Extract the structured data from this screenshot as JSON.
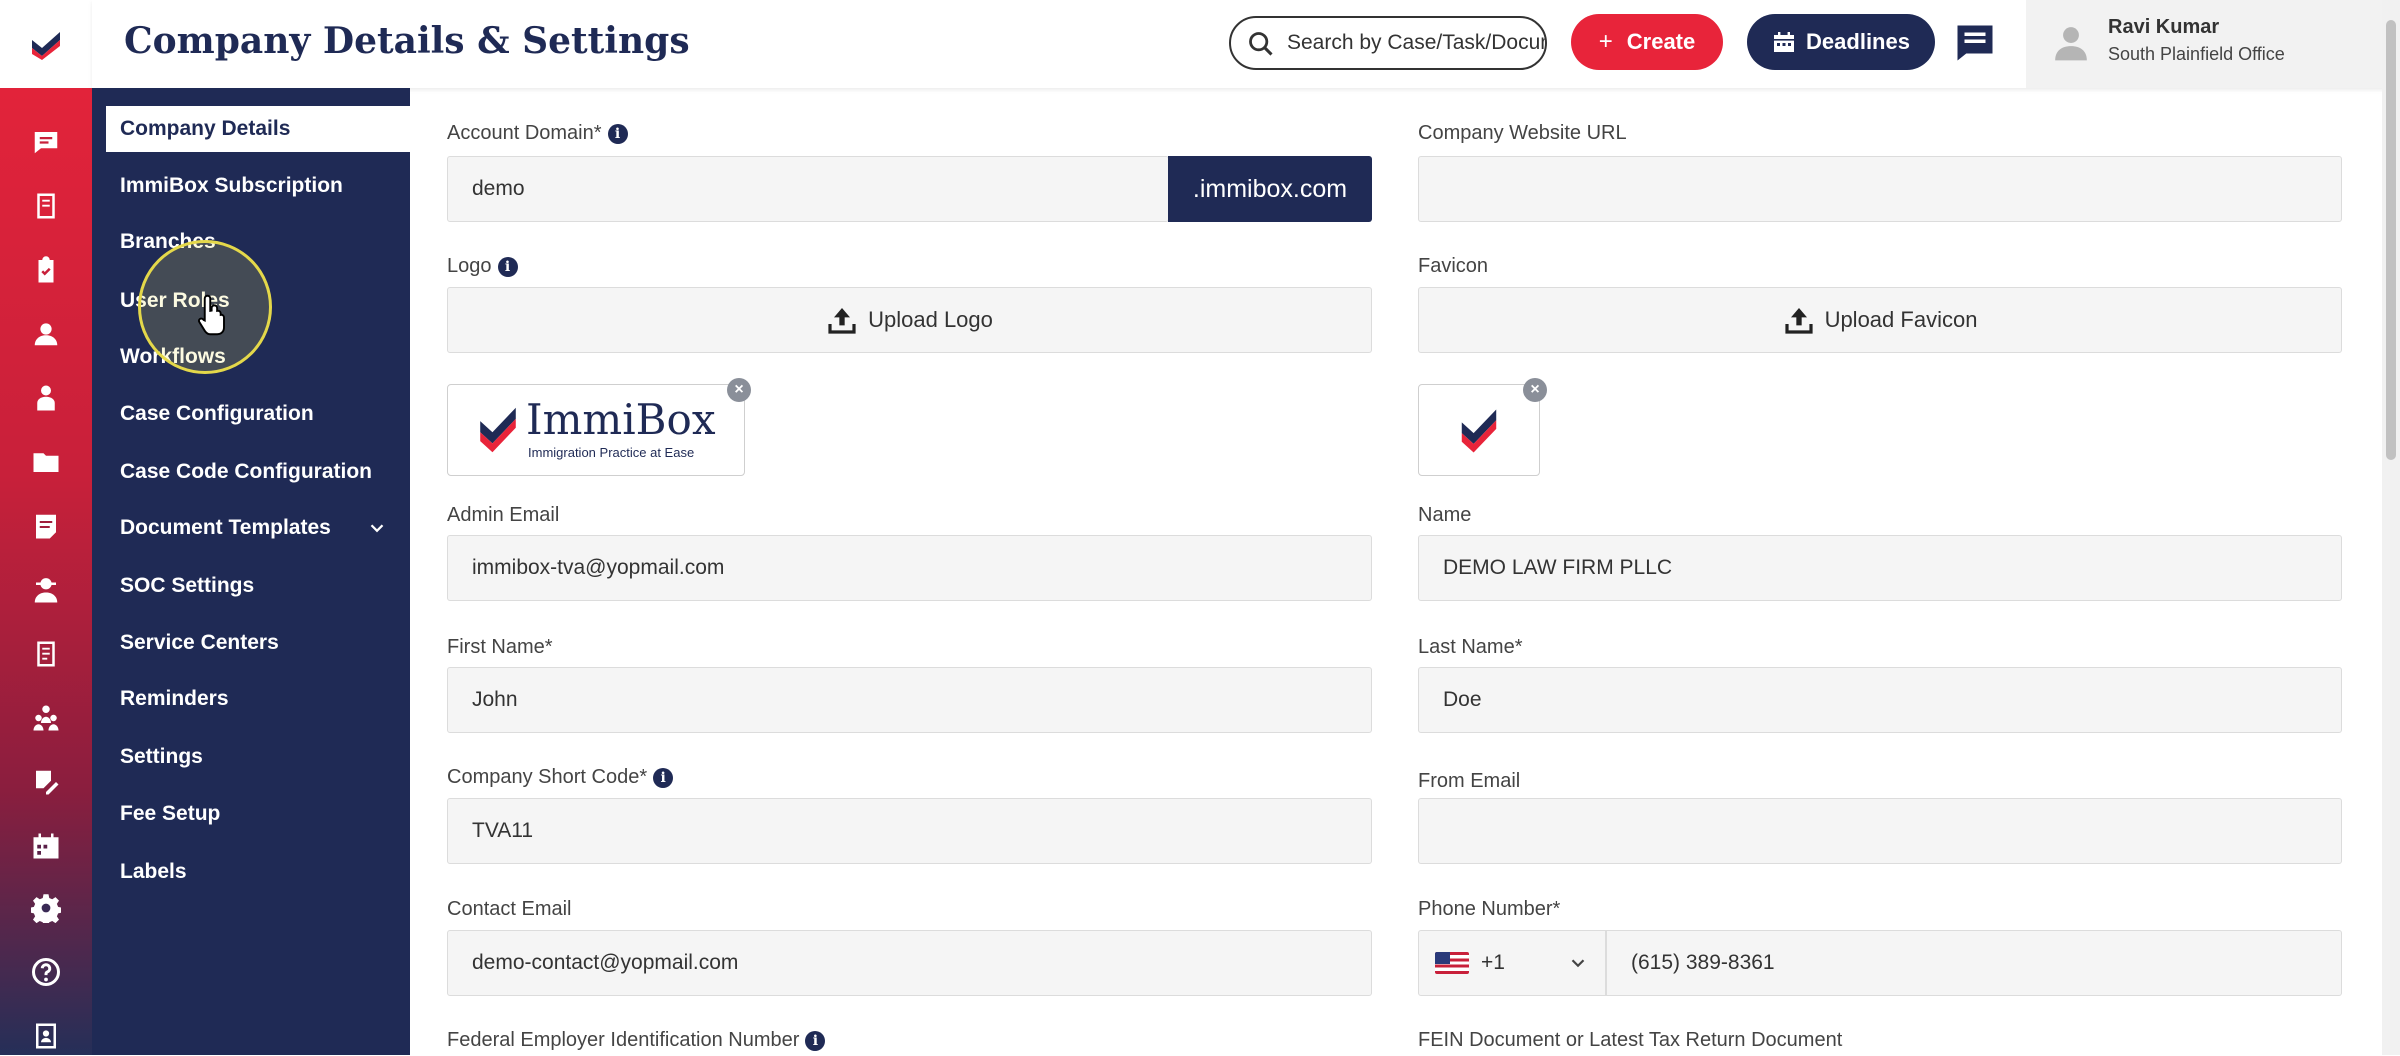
{
  "header": {
    "title": "Company Details & Settings",
    "search_placeholder": "Search by Case/Task/Document",
    "create_label": "Create",
    "deadlines_label": "Deadlines",
    "user_name": "Ravi Kumar",
    "user_office": "South Plainfield Office"
  },
  "sidebar": {
    "items": [
      {
        "label": "Company Details",
        "active": true
      },
      {
        "label": "ImmiBox Subscription"
      },
      {
        "label": "Branches"
      },
      {
        "label": "User Roles"
      },
      {
        "label": "Workflows"
      },
      {
        "label": "Case Configuration"
      },
      {
        "label": "Case Code Configuration"
      },
      {
        "label": "Document Templates",
        "has_submenu": true
      },
      {
        "label": "SOC Settings"
      },
      {
        "label": "Service Centers"
      },
      {
        "label": "Reminders"
      },
      {
        "label": "Settings"
      },
      {
        "label": "Fee Setup"
      },
      {
        "label": "Labels"
      }
    ]
  },
  "rail_icons": [
    "chat-icon",
    "book-icon",
    "clipboard-icon",
    "user-icon",
    "person-icon",
    "folder-icon",
    "document-icon",
    "agent-icon",
    "ledger-icon",
    "group-icon",
    "edit-icon",
    "calendar-icon",
    "gear-icon",
    "help-icon",
    "contacts-icon"
  ],
  "form": {
    "account_domain": {
      "label": "Account Domain*",
      "value": "demo",
      "suffix": ".immibox.com"
    },
    "company_website": {
      "label": "Company Website URL",
      "value": ""
    },
    "logo": {
      "label": "Logo",
      "upload_label": "Upload Logo",
      "logo_text": "ImmiBox",
      "logo_tagline": "Immigration Practice at Ease"
    },
    "favicon": {
      "label": "Favicon",
      "upload_label": "Upload Favicon"
    },
    "admin_email": {
      "label": "Admin Email",
      "value": "immibox-tva@yopmail.com"
    },
    "name": {
      "label": "Name",
      "value": "DEMO LAW FIRM PLLC"
    },
    "first_name": {
      "label": "First Name*",
      "value": "John"
    },
    "last_name": {
      "label": "Last Name*",
      "value": "Doe"
    },
    "company_short_code": {
      "label": "Company Short Code*",
      "value": "TVA11"
    },
    "from_email": {
      "label": "From Email",
      "value": ""
    },
    "contact_email": {
      "label": "Contact Email",
      "value": "demo-contact@yopmail.com"
    },
    "phone_number": {
      "label": "Phone Number*",
      "country_code": "+1",
      "value": "(615) 389-8361"
    },
    "fein": {
      "label": "Federal Employer Identification Number"
    },
    "fein_document": {
      "label": "FEIN Document or Latest Tax Return Document"
    }
  },
  "colors": {
    "brand_red": "#e8243a",
    "brand_navy": "#1f2a55"
  }
}
